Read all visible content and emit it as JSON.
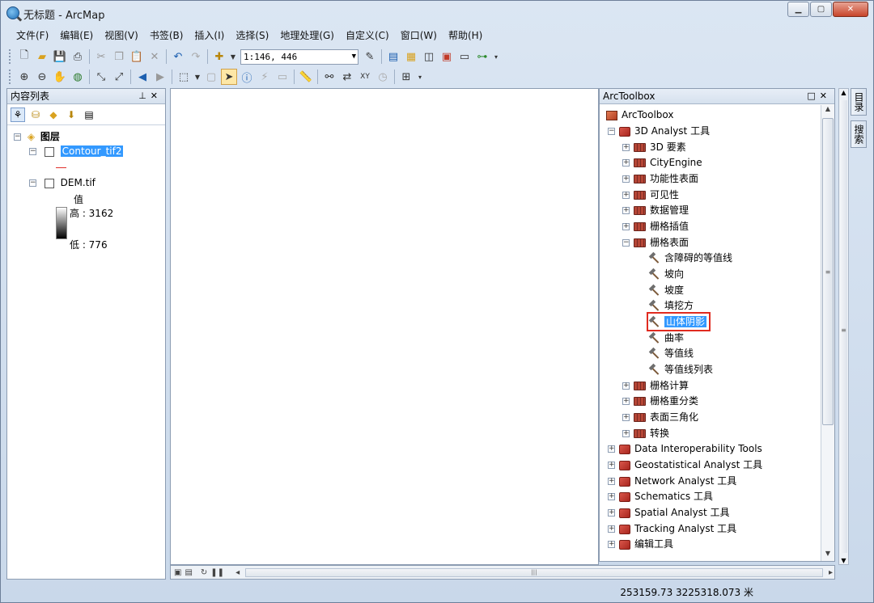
{
  "window": {
    "title": "无标题 - ArcMap"
  },
  "menu": [
    "文件(F)",
    "编辑(E)",
    "视图(V)",
    "书签(B)",
    "插入(I)",
    "选择(S)",
    "地理处理(G)",
    "自定义(C)",
    "窗口(W)",
    "帮助(H)"
  ],
  "toolbar": {
    "scale": "1:146, 446"
  },
  "toc": {
    "title": "内容列表",
    "root_label": "图层",
    "layer1": "Contour_tif2",
    "layer2": "DEM.tif",
    "legend_title": "值",
    "high": "高 : 3162",
    "low": "低 : 776"
  },
  "toolbox": {
    "title": "ArcToolbox",
    "root": "ArcToolbox",
    "items": [
      "3D Analyst 工具",
      "3D 要素",
      "CityEngine",
      "功能性表面",
      "可见性",
      "数据管理",
      "栅格插值",
      "栅格表面",
      "含障碍的等值线",
      "坡向",
      "坡度",
      "填挖方",
      "山体阴影",
      "曲率",
      "等值线",
      "等值线列表",
      "栅格计算",
      "栅格重分类",
      "表面三角化",
      "转换",
      "Data Interoperability Tools",
      "Geostatistical Analyst 工具",
      "Network Analyst 工具",
      "Schematics 工具",
      "Spatial Analyst 工具",
      "Tracking Analyst 工具",
      "编辑工具"
    ]
  },
  "side_tabs": [
    "目录",
    "搜索"
  ],
  "status": {
    "coords": "253159.73  3225318.073 米"
  }
}
